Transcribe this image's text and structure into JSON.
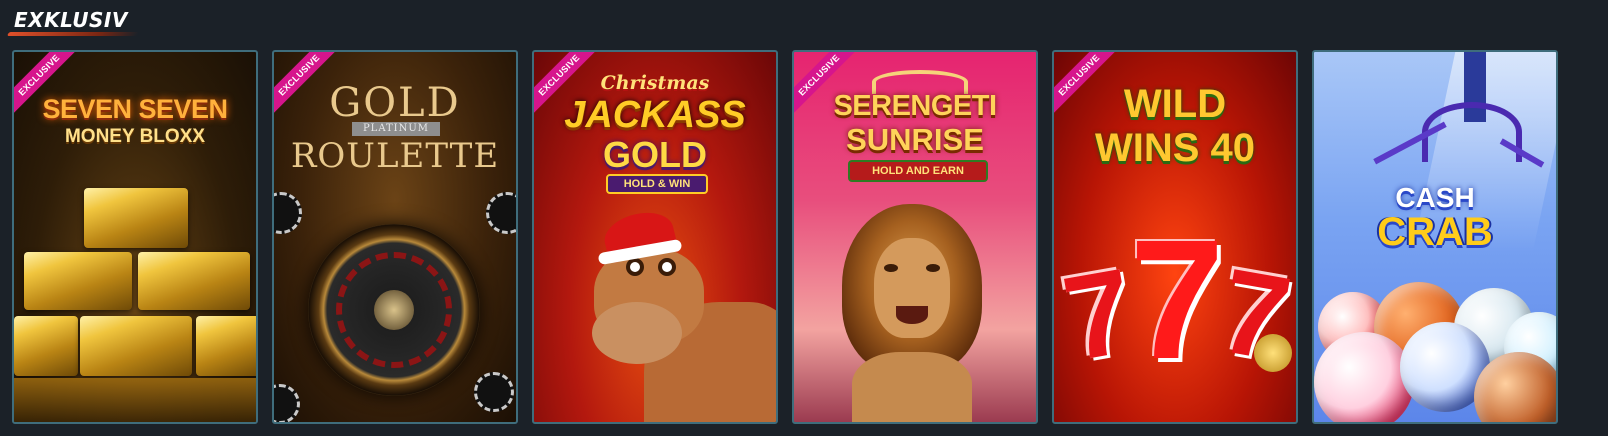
{
  "section": {
    "title": "EXKLUSIV"
  },
  "games": [
    {
      "name": "Seven Seven Money Bloxx",
      "badge": "EXCLUSIVE",
      "logo_line1": "SEVEN SEVEN",
      "logo_line2": "MONEY BLOXX"
    },
    {
      "name": "Gold Platinum Roulette",
      "badge": "EXCLUSIVE",
      "logo_line1": "GOLD",
      "logo_sub": "PLATINUM",
      "logo_line2": "ROULETTE"
    },
    {
      "name": "Christmas Jackass Gold Hold & Win",
      "badge": "EXCLUSIVE",
      "logo_top": "Christmas",
      "logo_line1": "JACKASS",
      "logo_line2": "GOLD",
      "logo_sub": "HOLD & WIN"
    },
    {
      "name": "Serengeti Sunrise Hold and Earn",
      "badge": "EXCLUSIVE",
      "logo_line1": "SERENGETI",
      "logo_line2": "SUNRISE",
      "logo_sub": "HOLD AND EARN"
    },
    {
      "name": "Wild Wins 40",
      "badge": "EXCLUSIVE",
      "logo_line1": "WILD",
      "logo_line2": "WINS 40"
    },
    {
      "name": "Cash Crab",
      "logo_line1": "CASH",
      "logo_line2": "CRAB"
    }
  ],
  "colors": {
    "background": "#1b2128",
    "card_border": "#3f6d7c",
    "badge": "#d6158c",
    "title_underline": "#e0502a"
  }
}
